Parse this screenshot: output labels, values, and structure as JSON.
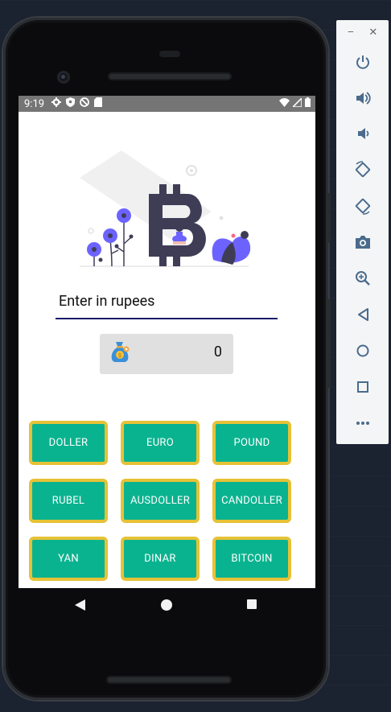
{
  "statusbar": {
    "time": "9:19"
  },
  "converter": {
    "input_placeholder": "Enter in rupees",
    "result_value": "0"
  },
  "buttons": [
    {
      "label": "DOLLER"
    },
    {
      "label": "EURO"
    },
    {
      "label": "POUND"
    },
    {
      "label": "RUBEL"
    },
    {
      "label": "AUSDOLLER"
    },
    {
      "label": "CANDOLLER"
    },
    {
      "label": "YAN"
    },
    {
      "label": "DINAR"
    },
    {
      "label": "BITCOIN"
    }
  ],
  "emulator_toolbar": {
    "window_controls": [
      "minimize-icon",
      "close-icon"
    ],
    "tools": [
      "power-icon",
      "volume-up-icon",
      "volume-down-icon",
      "rotate-left-icon",
      "rotate-right-icon",
      "camera-icon",
      "zoom-icon",
      "back-icon",
      "home-icon",
      "overview-icon",
      "more-icon"
    ]
  },
  "colors": {
    "accent": "#0ab38f",
    "button_border": "#e6c236",
    "underline": "#1a1a6b",
    "illustration_purple": "#6c63ff",
    "illustration_dark": "#3f3d56"
  }
}
